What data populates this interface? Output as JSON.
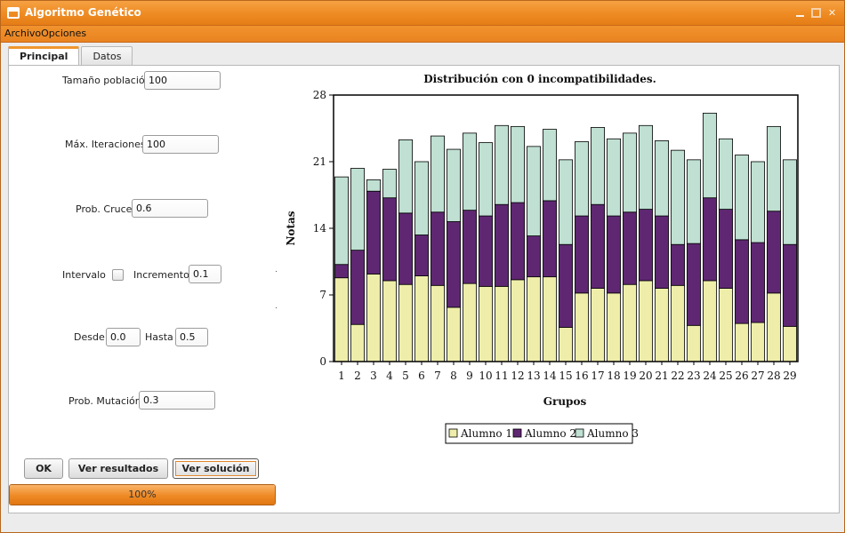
{
  "window": {
    "title": "Algoritmo Genético"
  },
  "menu": {
    "archivo": "Archivo",
    "opciones": "Opciones"
  },
  "tabs": {
    "principal": "Principal",
    "datos": "Datos"
  },
  "form": {
    "poblacion_label": "Tamaño población",
    "poblacion_value": "100",
    "iteraciones_label": "Máx. Iteraciones",
    "iteraciones_value": "100",
    "cruce_label": "Prob. Cruce",
    "cruce_value": "0.6",
    "intervalo_label": "Intervalo",
    "incremento_label": "Incremento",
    "incremento_value": "0.1",
    "desde_label": "Desde",
    "desde_value": "0.0",
    "hasta_label": "Hasta",
    "hasta_value": "0.5",
    "mutacion_label": "Prob. Mutación",
    "mutacion_value": "0.3"
  },
  "buttons": {
    "ok": "OK",
    "resultados": "Ver resultados",
    "solucion": "Ver solución"
  },
  "progress": {
    "value": 1.0,
    "label": "100%"
  },
  "colors": {
    "accent": "#ee8b22",
    "alumno1": "#eeeeaa",
    "alumno2": "#5f2772",
    "alumno3": "#bfe0d2"
  },
  "chart_data": {
    "type": "bar",
    "stacked": true,
    "title": "Distribución con 0 incompatibilidades.",
    "xlabel": "Grupos",
    "ylabel": "Notas",
    "ylim": [
      0,
      28
    ],
    "yticks": [
      0,
      7,
      14,
      21,
      28
    ],
    "categories": [
      "1",
      "2",
      "3",
      "4",
      "5",
      "6",
      "7",
      "8",
      "9",
      "10",
      "11",
      "12",
      "13",
      "14",
      "15",
      "16",
      "17",
      "18",
      "19",
      "20",
      "21",
      "22",
      "23",
      "24",
      "25",
      "26",
      "27",
      "28",
      "29"
    ],
    "legend_position": "bottom",
    "series": [
      {
        "name": "Alumno 1",
        "color": "#eeeeaa",
        "values": [
          8.8,
          3.9,
          9.2,
          8.5,
          8.1,
          9.0,
          8.0,
          5.7,
          8.2,
          7.9,
          7.9,
          8.6,
          8.9,
          8.9,
          3.6,
          7.2,
          7.7,
          7.2,
          8.1,
          8.5,
          7.7,
          8.0,
          3.8,
          8.5,
          7.7,
          4.0,
          4.1,
          7.2,
          3.7
        ]
      },
      {
        "name": "Alumno 2",
        "color": "#5f2772",
        "values": [
          1.4,
          7.8,
          8.7,
          8.7,
          7.5,
          4.3,
          7.7,
          9.0,
          7.7,
          7.4,
          8.6,
          8.1,
          4.3,
          8.0,
          8.7,
          8.1,
          8.8,
          8.1,
          7.6,
          7.5,
          7.6,
          4.3,
          8.6,
          8.7,
          8.3,
          8.8,
          8.4,
          8.6,
          8.6
        ]
      },
      {
        "name": "Alumno 3",
        "color": "#bfe0d2",
        "values": [
          9.2,
          8.6,
          1.2,
          3.0,
          7.7,
          7.7,
          8.0,
          7.6,
          8.1,
          7.7,
          8.3,
          8.0,
          9.4,
          7.5,
          8.9,
          7.8,
          8.1,
          8.1,
          8.3,
          8.8,
          7.9,
          9.9,
          8.8,
          8.9,
          7.4,
          8.9,
          8.5,
          8.9,
          8.9
        ]
      }
    ]
  }
}
